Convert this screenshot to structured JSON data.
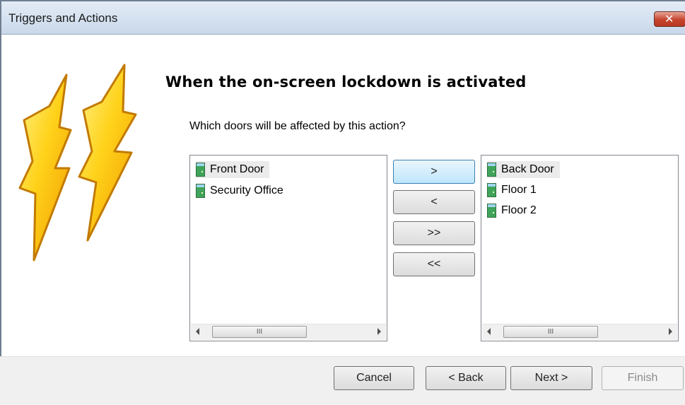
{
  "window": {
    "title": "Triggers and Actions",
    "close_glyph": "✕"
  },
  "logo": {
    "icon": "lightning-bolts-icon"
  },
  "page": {
    "heading": "When the on-screen lockdown is activated",
    "question": "Which doors will be affected by this action?"
  },
  "available_doors": [
    {
      "label": "Front Door",
      "selected": true
    },
    {
      "label": "Security Office",
      "selected": false
    }
  ],
  "affected_doors": [
    {
      "label": "Back Door",
      "selected": true
    },
    {
      "label": "Floor 1",
      "selected": false
    },
    {
      "label": "Floor 2",
      "selected": false
    }
  ],
  "scroll_thumb_grip": "III",
  "move_buttons": {
    "add": ">",
    "remove": "<",
    "add_all": ">>",
    "remove_all": "<<"
  },
  "footer": {
    "cancel": "Cancel",
    "back": "< Back",
    "next": "Next >",
    "finish": "Finish"
  }
}
